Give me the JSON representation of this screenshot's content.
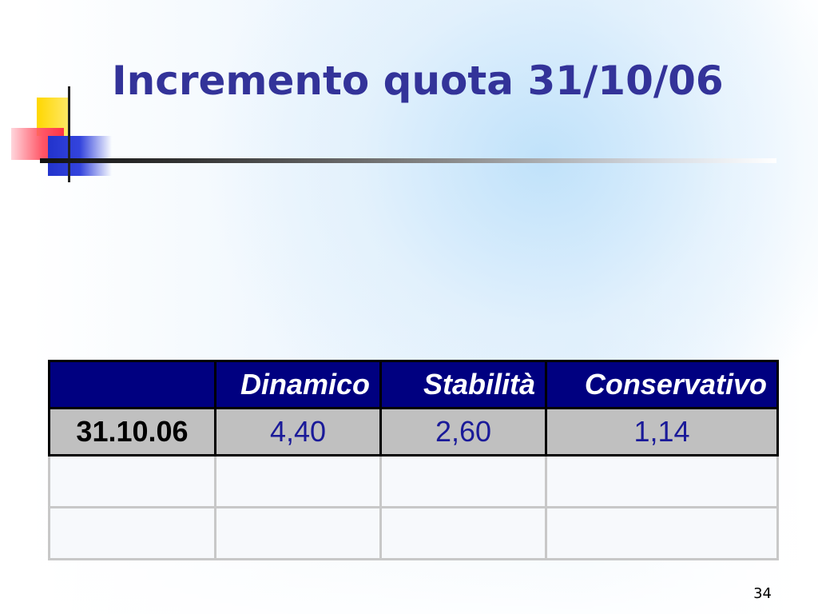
{
  "slide": {
    "title": "Incremento quota 31/10/06",
    "page_number": "34"
  },
  "table": {
    "columns": [
      "",
      "Dinamico",
      "Stabilità",
      "Conservativo"
    ],
    "rows": [
      [
        "31.10.06",
        "4,40",
        "2,60",
        "1,14"
      ],
      [
        "",
        "",
        "",
        ""
      ],
      [
        "",
        "",
        "",
        ""
      ]
    ]
  },
  "colors": {
    "title": "#333399",
    "header_bg": "#000080",
    "header_text": "#ffffff",
    "data_bg": "#c0c0c0",
    "value_text": "#1a1a99"
  },
  "icons": [
    "logo-mark-icon"
  ]
}
